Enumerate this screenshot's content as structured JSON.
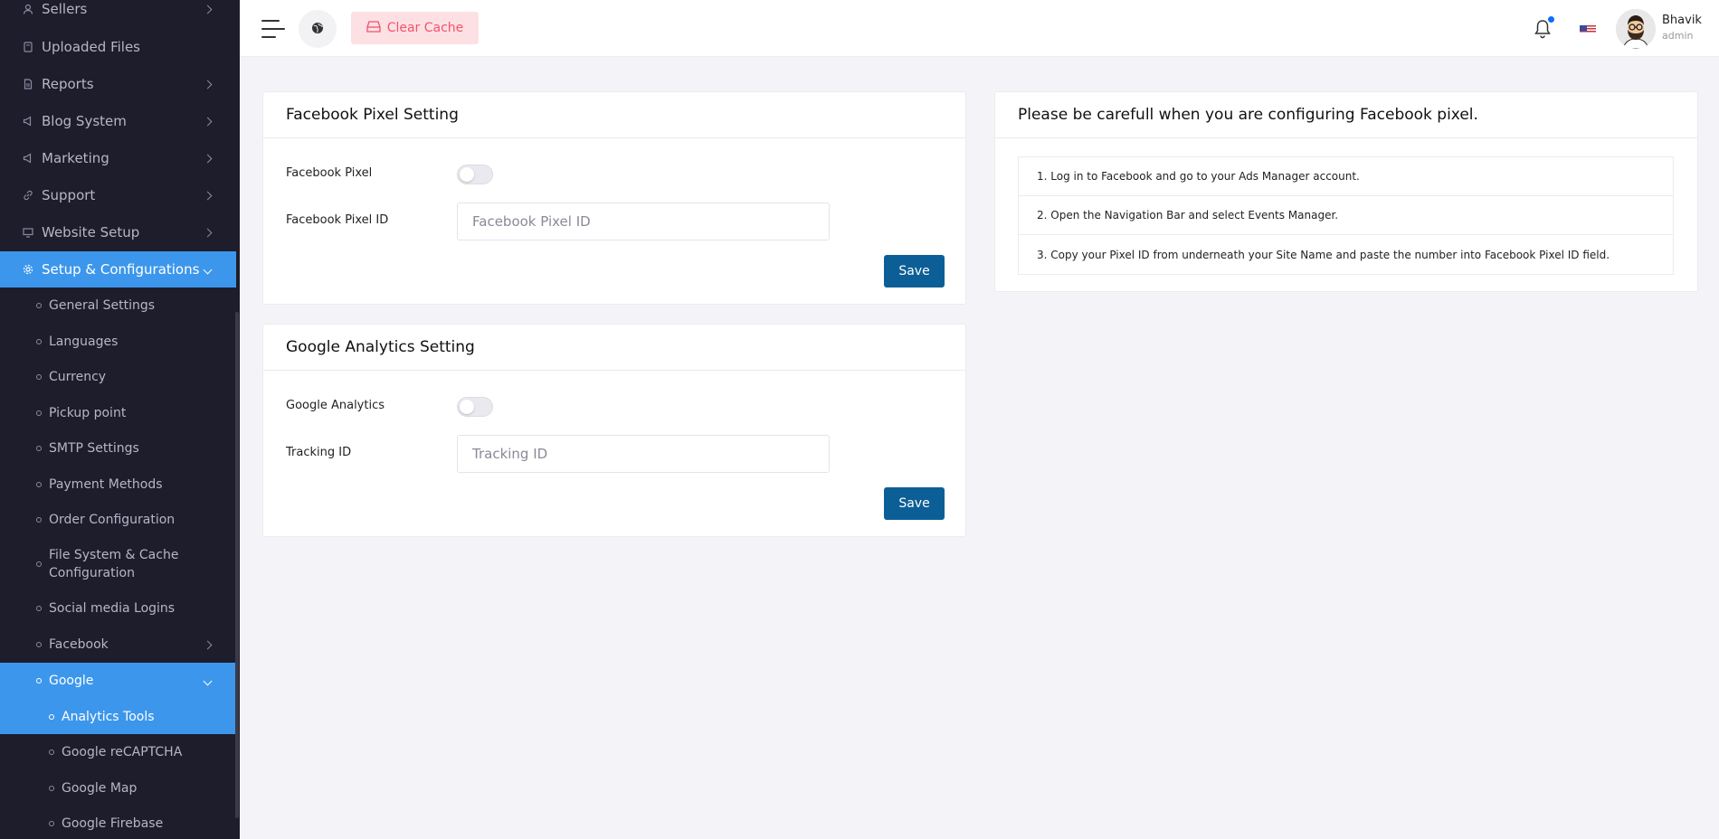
{
  "sidebar": {
    "items": [
      {
        "label": "Sellers",
        "icon": "user-icon",
        "has_chevron": true
      },
      {
        "label": "Uploaded Files",
        "icon": "folder-icon",
        "has_chevron": false
      },
      {
        "label": "Reports",
        "icon": "file-icon",
        "has_chevron": true
      },
      {
        "label": "Blog System",
        "icon": "megaphone-icon",
        "has_chevron": true
      },
      {
        "label": "Marketing",
        "icon": "megaphone-icon",
        "has_chevron": true
      },
      {
        "label": "Support",
        "icon": "link-icon",
        "has_chevron": true
      },
      {
        "label": "Website Setup",
        "icon": "monitor-icon",
        "has_chevron": true
      },
      {
        "label": "Setup & Configurations",
        "icon": "gear-icon",
        "has_chevron": true,
        "active": true
      }
    ],
    "sub_items": [
      {
        "label": "General Settings"
      },
      {
        "label": "Languages"
      },
      {
        "label": "Currency"
      },
      {
        "label": "Pickup point"
      },
      {
        "label": "SMTP Settings"
      },
      {
        "label": "Payment Methods"
      },
      {
        "label": "Order Configuration"
      },
      {
        "label": "File System & Cache Configuration",
        "label_line1": "File System & Cache",
        "label_line2": "Configuration"
      },
      {
        "label": "Social media Logins"
      },
      {
        "label": "Facebook",
        "has_chevron": true
      },
      {
        "label": "Google",
        "has_chevron": true,
        "active": true
      }
    ],
    "google_sub_items": [
      {
        "label": "Analytics Tools",
        "active": true
      },
      {
        "label": "Google reCAPTCHA"
      },
      {
        "label": "Google Map"
      },
      {
        "label": "Google Firebase"
      }
    ]
  },
  "topbar": {
    "clear_cache_label": "Clear Cache",
    "user_name": "Bhavik",
    "user_role": "admin",
    "notification_dot": true
  },
  "facebook_card": {
    "title": "Facebook Pixel Setting",
    "toggle_label": "Facebook Pixel",
    "toggle_on": false,
    "id_label": "Facebook Pixel ID",
    "id_placeholder": "Facebook Pixel ID",
    "id_value": "",
    "save_label": "Save"
  },
  "google_card": {
    "title": "Google Analytics Setting",
    "toggle_label": "Google Analytics",
    "toggle_on": false,
    "id_label": "Tracking ID",
    "id_placeholder": "Tracking ID",
    "id_value": "",
    "save_label": "Save"
  },
  "info_card": {
    "title": "Please be carefull when you are configuring Facebook pixel.",
    "steps": [
      "1. Log in to Facebook and go to your Ads Manager account.",
      "2. Open the Navigation Bar and select Events Manager.",
      "3. Copy your Pixel ID from underneath your Site Name and paste the number into Facebook Pixel ID field."
    ]
  },
  "colors": {
    "sidebar_bg": "#1d1d2b",
    "active_bg": "#3c97ec",
    "save_btn": "#0c5f96",
    "clear_cache_bg": "#fde0e3",
    "clear_cache_text": "#f1536e"
  }
}
